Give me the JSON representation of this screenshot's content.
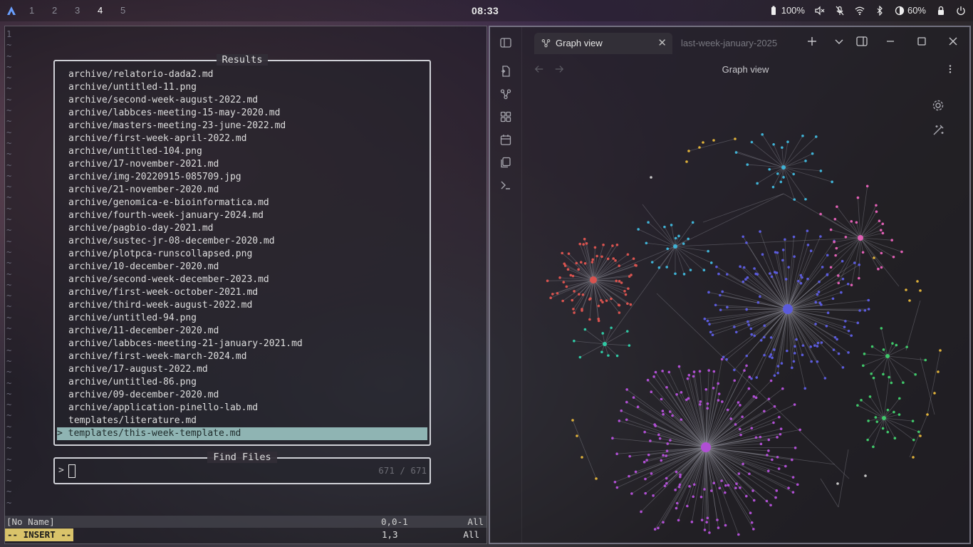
{
  "topbar": {
    "workspaces": [
      "1",
      "2",
      "3",
      "4",
      "5"
    ],
    "active_workspace": "4",
    "clock": "08:33",
    "battery": "100%",
    "brightness": "60%"
  },
  "terminal": {
    "gutter_first": "1",
    "gutter_filler": "~",
    "results_title": "Results",
    "results": [
      "archive/relatorio-dada2.md",
      "archive/untitled-11.png",
      "archive/second-week-august-2022.md",
      "archive/labbces-meeting-15-may-2020.md",
      "archive/masters-meeting-23-june-2022.md",
      "archive/first-week-april-2022.md",
      "archive/untitled-104.png",
      "archive/17-november-2021.md",
      "archive/img-20220915-085709.jpg",
      "archive/21-november-2020.md",
      "archive/genomica-e-bioinformatica.md",
      "archive/fourth-week-january-2024.md",
      "archive/pagbio-day-2021.md",
      "archive/sustec-jr-08-december-2020.md",
      "archive/plotpca-runscollapsed.png",
      "archive/10-december-2020.md",
      "archive/second-week-december-2023.md",
      "archive/first-week-october-2021.md",
      "archive/third-week-august-2022.md",
      "archive/untitled-94.png",
      "archive/11-december-2020.md",
      "archive/labbces-meeting-21-january-2021.md",
      "archive/first-week-march-2024.md",
      "archive/17-august-2022.md",
      "archive/untitled-86.png",
      "archive/09-december-2020.md",
      "archive/application-pinello-lab.md",
      "templates/literature.md"
    ],
    "selected_result": "> templates/this-week-template.md",
    "find_title": "Find Files",
    "prompt": ">",
    "count": "671 / 671",
    "status": {
      "name": "[No Name]",
      "pos": "0,0-1",
      "scroll": "All"
    },
    "cmd": {
      "mode": "-- INSERT --",
      "pos": "1,3",
      "scroll": "All"
    }
  },
  "obsidian": {
    "tab_active": "Graph view",
    "tab_inactive": "last-week-january-2025",
    "view_title": "Graph view",
    "cluster_colors": [
      "#5b5bdc",
      "#b04fd4",
      "#d9534f",
      "#e05fb4",
      "#3fb3d6",
      "#3fc96a",
      "#e0b23a",
      "#2fc9a4"
    ]
  }
}
